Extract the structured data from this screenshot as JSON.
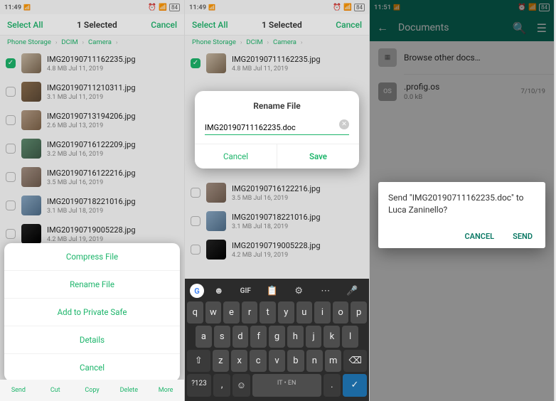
{
  "accent": "#1db56b",
  "whatsapp_accent": "#0a7864",
  "shot1": {
    "status": {
      "time": "11:49",
      "signal_left": "📶",
      "right_icons": "⏰ 🕑 ✱ 📶 84",
      "battery": "84"
    },
    "selbar": {
      "select_all": "Select All",
      "title": "1 Selected",
      "cancel": "Cancel"
    },
    "crumbs": {
      "p0": "Phone Storage",
      "p1": "DCIM",
      "p2": "Camera"
    },
    "files": [
      {
        "name": "IMG20190711162235.jpg",
        "size": "4.8 MB",
        "date": "Jul 11, 2019",
        "checked": true
      },
      {
        "name": "IMG20190711210311.jpg",
        "size": "3.1 MB",
        "date": "Jul 11, 2019",
        "checked": false
      },
      {
        "name": "IMG20190713194206.jpg",
        "size": "2.6 MB",
        "date": "Jul 13, 2019",
        "checked": false
      },
      {
        "name": "IMG20190716122209.jpg",
        "size": "3.2 MB",
        "date": "Jul 16, 2019",
        "checked": false
      },
      {
        "name": "IMG20190716122216.jpg",
        "size": "3.5 MB",
        "date": "Jul 16, 2019",
        "checked": false
      },
      {
        "name": "IMG20190718221016.jpg",
        "size": "3.1 MB",
        "date": "Jul 18, 2019",
        "checked": false
      },
      {
        "name": "IMG20190719005228.jpg",
        "size": "4.2 MB",
        "date": "Jul 19, 2019",
        "checked": false
      }
    ],
    "sheet": {
      "compress": "Compress File",
      "rename": "Rename File",
      "private": "Add to Private Safe",
      "details": "Details",
      "cancel": "Cancel"
    },
    "toolbar": {
      "send": "Send",
      "cut": "Cut",
      "copy": "Copy",
      "delete": "Delete",
      "more": "More"
    }
  },
  "shot2": {
    "status": {
      "time": "11:49",
      "right_icons": "⏰ 🕑 ✱ 📶 84",
      "battery": "84"
    },
    "selbar": {
      "select_all": "Select All",
      "title": "1 Selected",
      "cancel": "Cancel"
    },
    "crumbs": {
      "p0": "Phone Storage",
      "p1": "DCIM",
      "p2": "Camera"
    },
    "dialog": {
      "title": "Rename File",
      "value": "IMG20190711162235.doc",
      "cancel": "Cancel",
      "save": "Save"
    },
    "files_visible": [
      {
        "name": "IMG20190711162235.jpg",
        "size": "4.8 MB",
        "date": "Jul 11, 2019",
        "checked": true
      },
      {
        "name": "IMG20190716122216.jpg",
        "size": "3.5 MB",
        "date": "Jul 16, 2019",
        "checked": false
      },
      {
        "name": "IMG20190718221016.jpg",
        "size": "3.1 MB",
        "date": "Jul 18, 2019",
        "checked": false
      },
      {
        "name": "IMG20190719005228.jpg",
        "size": "4.2 MB",
        "date": "Jul 19, 2019",
        "checked": false
      }
    ],
    "keyboard": {
      "top": {
        "gif": "GIF",
        "lang": "IT • EN",
        "numsym": "?123"
      },
      "row1": [
        "q",
        "w",
        "e",
        "r",
        "t",
        "y",
        "u",
        "i",
        "o",
        "p"
      ],
      "row2": [
        "a",
        "s",
        "d",
        "f",
        "g",
        "h",
        "j",
        "k",
        "l"
      ],
      "row3_shift": "⇧",
      "row3": [
        "z",
        "x",
        "c",
        "v",
        "b",
        "n",
        "m"
      ],
      "row3_del": "⌫"
    }
  },
  "shot3": {
    "status": {
      "time": "11:51",
      "right_icons": "⏰ 🕑 ✱ 📶 84",
      "battery": "84"
    },
    "header": {
      "title": "Documents"
    },
    "browse": {
      "label": "Browse other docs…"
    },
    "doc": {
      "name": ".profig.os",
      "size": "0.0 kB",
      "date": "7/10/19",
      "badge": "OS"
    },
    "confirm": {
      "text": "Send \"IMG20190711162235.doc\" to Luca Zaninello?",
      "cancel": "CANCEL",
      "send": "SEND"
    }
  }
}
